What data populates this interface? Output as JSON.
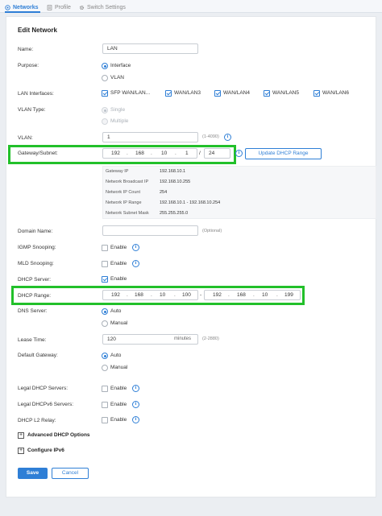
{
  "tabs": [
    {
      "label": "Networks",
      "icon": "network-icon"
    },
    {
      "label": "Profile",
      "icon": "profile-icon"
    },
    {
      "label": "Switch Settings",
      "icon": "gear-icon"
    }
  ],
  "form_title": "Edit Network",
  "labels": {
    "name": "Name:",
    "purpose": "Purpose:",
    "lan_interfaces": "LAN Interfaces:",
    "vlan_type": "VLAN Type:",
    "vlan": "VLAN:",
    "gateway_subnet": "Gateway/Subnet:",
    "domain_name": "Domain Name:",
    "igmp_snooping": "IGMP Snooping:",
    "mld_snooping": "MLD Snooping:",
    "dhcp_server": "DHCP Server:",
    "dhcp_range": "DHCP Range:",
    "dns_server": "DNS Server:",
    "lease_time": "Lease Time:",
    "default_gateway": "Default Gateway:",
    "legal_dhcp_servers": "Legal DHCP Servers:",
    "legal_dhcpv6_servers": "Legal DHCPv6 Servers:",
    "dhcp_l2_relay": "DHCP L2 Relay:"
  },
  "name_value": "LAN",
  "purpose_options": [
    "Interface",
    "VLAN"
  ],
  "lan_interfaces": [
    "SFP WAN/LAN...",
    "WAN/LAN3",
    "WAN/LAN4",
    "WAN/LAN5",
    "WAN/LAN6"
  ],
  "vlan_type_options": [
    "Single",
    "Multiple"
  ],
  "vlan_value": "1",
  "vlan_hint": "(1-4090)",
  "gateway": {
    "o1": "192",
    "o2": "168",
    "o3": "10",
    "o4": "1",
    "sep": "/",
    "mask": "24"
  },
  "update_dhcp_range_label": "Update DHCP Range",
  "network_info": [
    {
      "k": "Gateway IP",
      "v": "192.168.10.1"
    },
    {
      "k": "Network Broadcast IP",
      "v": "192.168.10.255"
    },
    {
      "k": "Network IP Count",
      "v": "254"
    },
    {
      "k": "Network IP Range",
      "v": "192.168.10.1 - 192.168.10.254"
    },
    {
      "k": "Network Subnet Mask",
      "v": "255.255.255.0"
    }
  ],
  "domain_hint": "(Optional)",
  "enable_label": "Enable",
  "dhcp_range": {
    "start": [
      "192",
      "168",
      "10",
      "100"
    ],
    "dash": "-",
    "end": [
      "192",
      "168",
      "10",
      "199"
    ]
  },
  "dns_options": [
    "Auto",
    "Manual"
  ],
  "lease_time_value": "120",
  "lease_time_unit": "minutes",
  "lease_time_hint": "(2-2880)",
  "default_gateway_options": [
    "Auto",
    "Manual"
  ],
  "advanced_dhcp_label": "Advanced DHCP Options",
  "configure_ipv6_label": "Configure IPv6",
  "save_label": "Save",
  "cancel_label": "Cancel",
  "colors": {
    "accent": "#2f7fd6",
    "highlight": "#22c02a"
  }
}
